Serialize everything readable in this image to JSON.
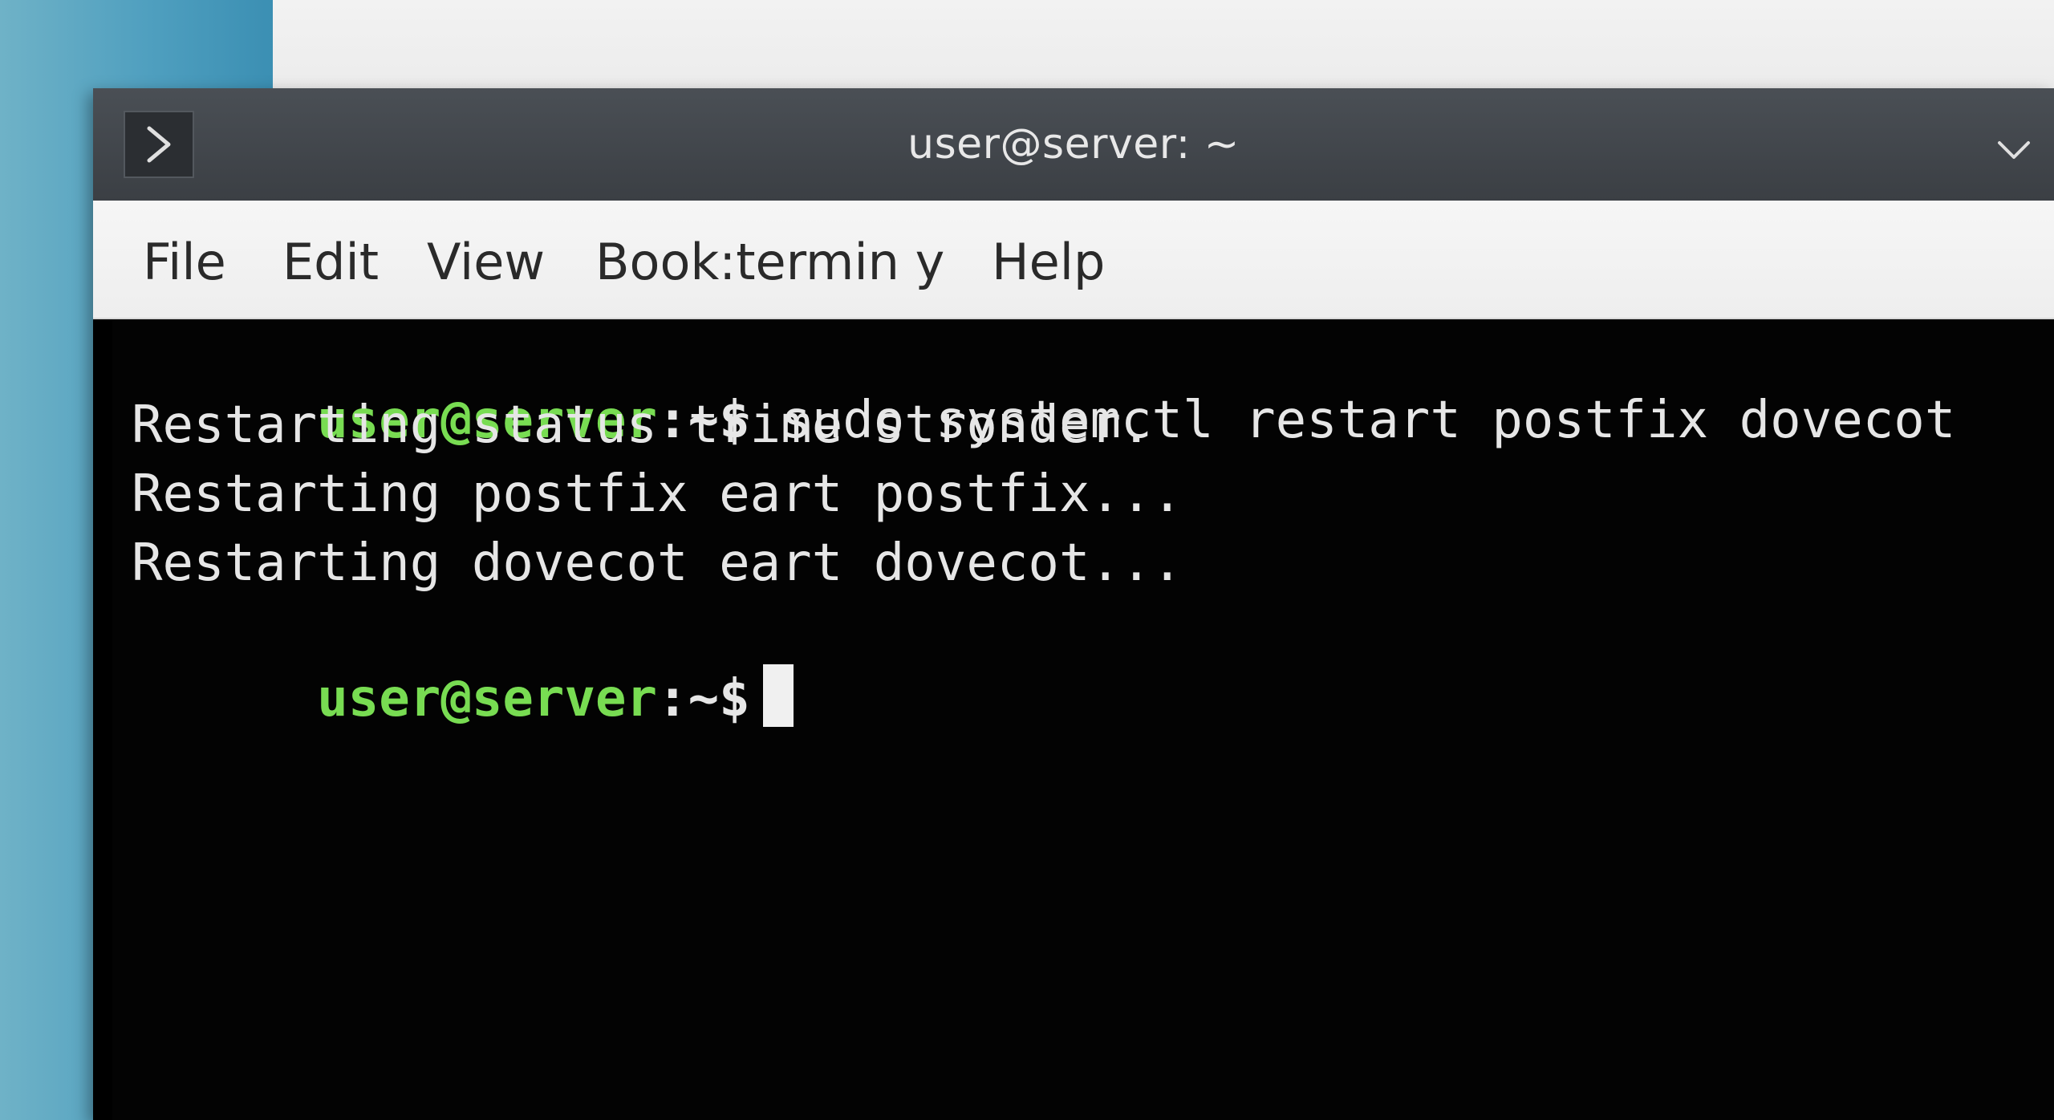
{
  "window": {
    "title": "user@server: ~"
  },
  "menu": {
    "items": [
      {
        "label": "File"
      },
      {
        "label": "Edit"
      },
      {
        "label": "View"
      },
      {
        "label": "Book:termin y"
      },
      {
        "label": "Help"
      }
    ]
  },
  "terminal": {
    "prompt_user": "user@server",
    "prompt_symbol": ":~$",
    "command": " sudo systemctl restart postfix dovecot",
    "output": [
      "Restarting status trime stronder.",
      "Restarting postfix eart postfix...",
      "Restarting dovecot eart dovecot..."
    ]
  },
  "icons": {
    "app": "terminal-prompt-icon",
    "menu": "chevron-down-icon"
  },
  "colors": {
    "prompt_green": "#78dc52",
    "terminal_bg": "#030303",
    "titlebar": "#3b3f44"
  }
}
